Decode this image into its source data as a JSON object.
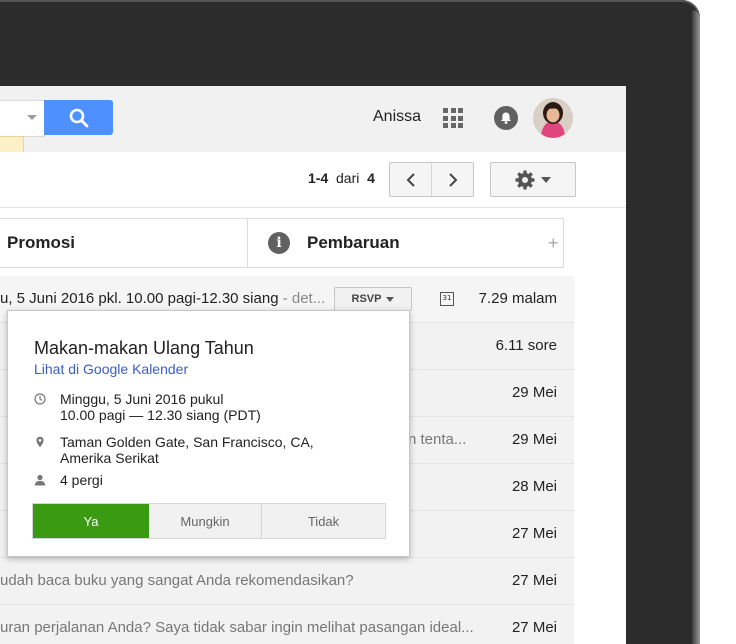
{
  "header": {
    "user_name": "Anissa"
  },
  "toolbar": {
    "pager_range": "1-4",
    "pager_of": "dari",
    "pager_total": "4"
  },
  "tabs": {
    "promosi": "Promosi",
    "pembaruan": "Pembaruan",
    "add": "+"
  },
  "rows": [
    {
      "subject": "u, 5 Juni 2016 pkl. 10.00 pagi-12.30 siang",
      "subject_suffix": " - det...",
      "rsvp": "RSVP",
      "date": "7.29 malam"
    },
    {
      "snippet": "",
      "date": "6.11 sore"
    },
    {
      "snippet": "",
      "date": "29 Mei"
    },
    {
      "snippet": "n tenta...",
      "date": "29 Mei"
    },
    {
      "snippet": "",
      "date": "28 Mei"
    },
    {
      "snippet": "",
      "date": "27 Mei"
    },
    {
      "snippet": "udah baca buku yang sangat Anda rekomendasikan?",
      "date": "27 Mei"
    },
    {
      "snippet": "uran perjalanan Anda? Saya tidak sabar ingin melihat pasangan ideal...",
      "date": "27 Mei"
    }
  ],
  "event": {
    "title": "Makan-makan Ulang Tahun",
    "calendar_link": "Lihat di Google Kalender",
    "when_line1": "Minggu, 5 Juni 2016 pukul",
    "when_line2": "10.00 pagi — 12.30 siang (PDT)",
    "where_line1": "Taman Golden Gate, San Francisco, CA,",
    "where_line2": "Amerika Serikat",
    "guests": "4 pergi",
    "yes": "Ya",
    "maybe": "Mungkin",
    "no": "Tidak"
  },
  "colors": {
    "search_button": "#4d90fe",
    "yes_button": "#3a9b13",
    "link": "#3b5ec6"
  }
}
